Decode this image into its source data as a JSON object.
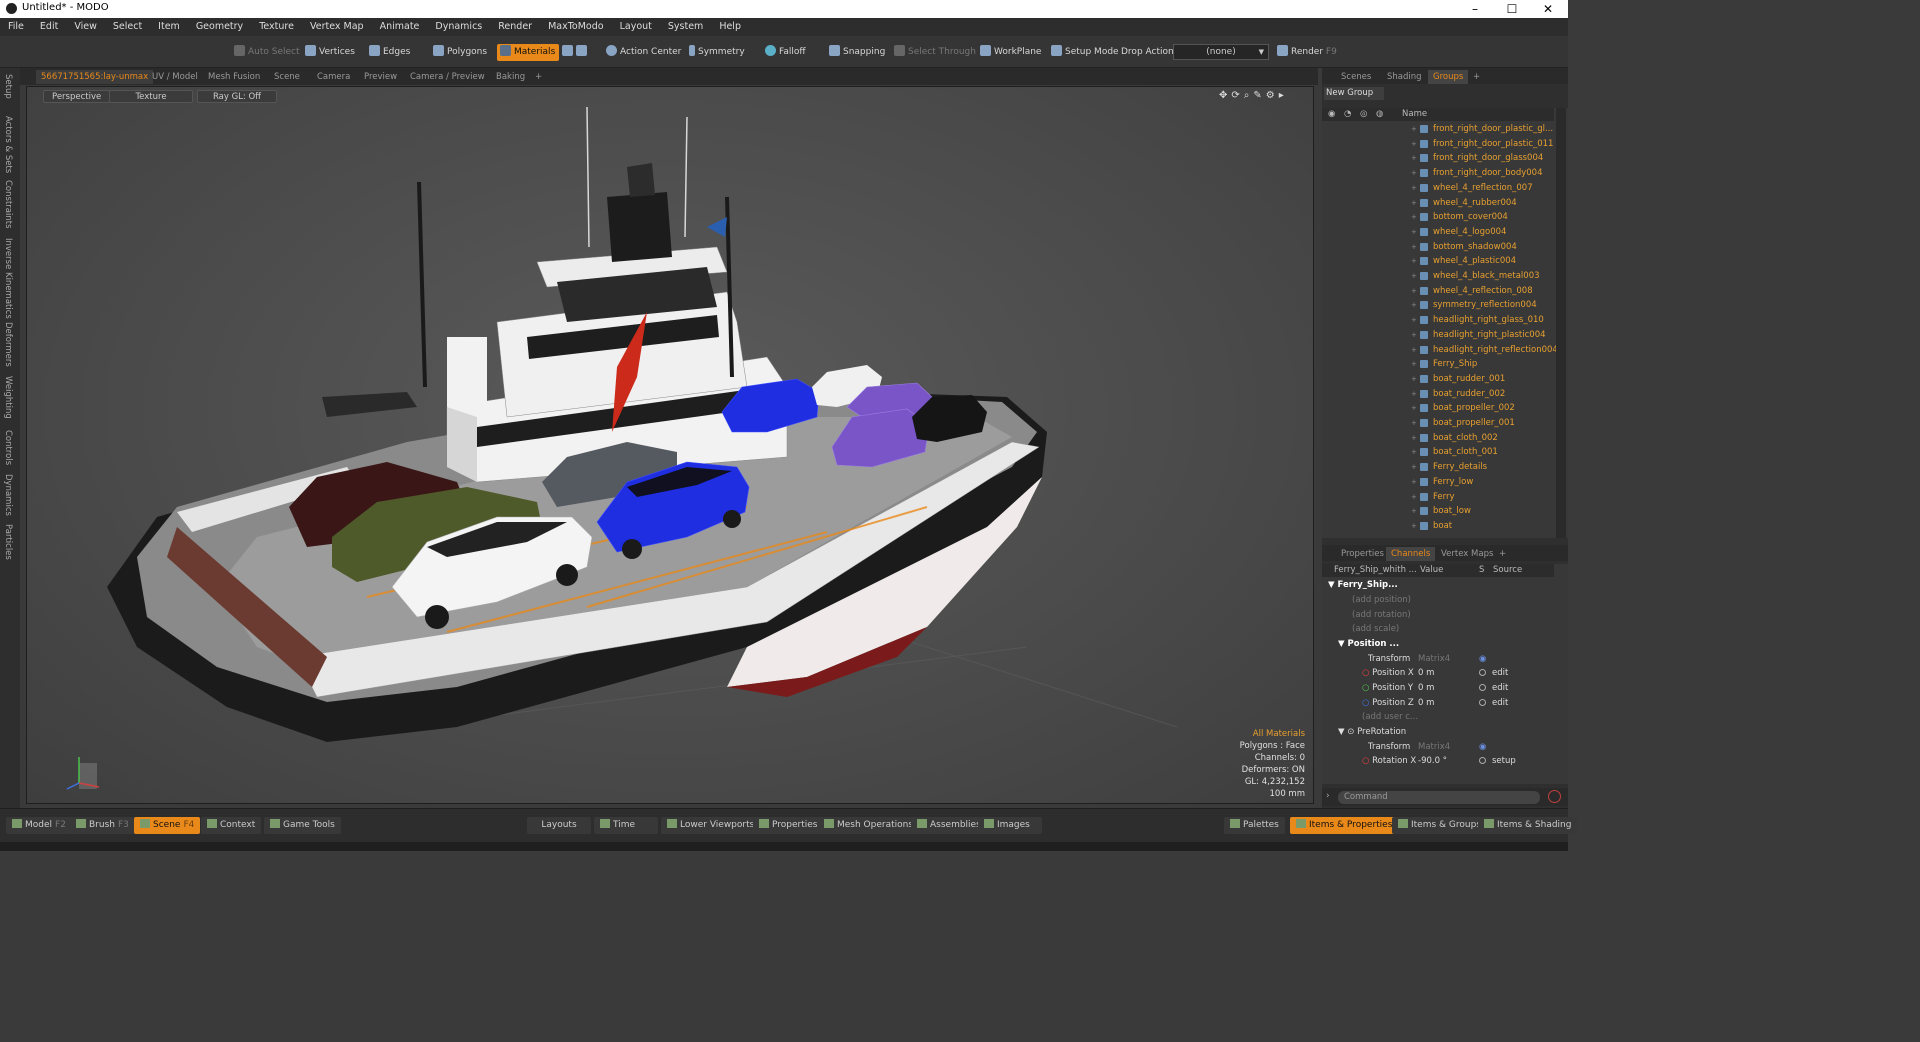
{
  "titlebar": {
    "title": "Untitled* - MODO",
    "minimize": "–",
    "maximize": "☐",
    "close": "✕"
  },
  "menu": [
    "File",
    "Edit",
    "View",
    "Select",
    "Item",
    "Geometry",
    "Texture",
    "Vertex Map",
    "Animate",
    "Dynamics",
    "Render",
    "MaxToModo",
    "Layout",
    "System",
    "Help"
  ],
  "toolbar": {
    "auto_select": "Auto Select",
    "vertices": "Vertices",
    "edges": "Edges",
    "polygons": "Polygons",
    "materials": "Materials",
    "action_center": "Action Center",
    "symmetry": "Symmetry",
    "falloff": "Falloff",
    "snapping": "Snapping",
    "select_through": "Select Through",
    "workplane": "WorkPlane",
    "setup_mode": "Setup Mode",
    "drop_action": "Drop Action",
    "drop_value": "(none)",
    "render": "Render",
    "render_key": "F9"
  },
  "left_tabs": [
    "Setup",
    "Actors & Sets",
    "Constraints",
    "Inverse Kinematics",
    "Deformers",
    "Weighting",
    "Controls",
    "Dynamics",
    "Particles"
  ],
  "viewport_tabs": [
    "56671751565:lay-unmax",
    "UV / Model",
    "Mesh Fusion",
    "Scene",
    "Camera",
    "Preview",
    "Camera / Preview",
    "Baking",
    "+"
  ],
  "viewport": {
    "perspective": "Perspective",
    "texture": "Texture",
    "raygl": "Ray GL: Off"
  },
  "stats": {
    "all_materials": "All Materials",
    "polygons": "Polygons : Face",
    "channels": "Channels: 0",
    "deformers": "Deformers: ON",
    "gl": "GL: 4,232,152",
    "scale": "100 mm"
  },
  "right_tabs_top": [
    "Scenes",
    "Shading",
    "Groups",
    "+"
  ],
  "new_group": "New Group",
  "tree_header": "Name",
  "tree_items": [
    "front_right_door_plastic_gl...",
    "front_right_door_plastic_011",
    "front_right_door_glass004",
    "front_right_door_body004",
    "wheel_4_reflection_007",
    "wheel_4_rubber004",
    "bottom_cover004",
    "wheel_4_logo004",
    "bottom_shadow004",
    "wheel_4_plastic004",
    "wheel_4_black_metal003",
    "wheel_4_reflection_008",
    "symmetry_reflection004",
    "headlight_right_glass_010",
    "headlight_right_plastic004",
    "headlight_right_reflection004",
    "Ferry_Ship",
    "boat_rudder_001",
    "boat_rudder_002",
    "boat_propeller_002",
    "boat_propeller_001",
    "boat_cloth_002",
    "boat_cloth_001",
    "Ferry_details",
    "Ferry_low",
    "Ferry",
    "boat_low",
    "boat"
  ],
  "right_tabs_bottom": [
    "Properties",
    "Channels",
    "Vertex Maps",
    "+"
  ],
  "channels_header": {
    "name": "Ferry_Ship_whith ...",
    "value": "Value",
    "s": "S",
    "source": "Source"
  },
  "channels": [
    {
      "name": "Ferry_Ship...",
      "value": "",
      "source": ""
    },
    {
      "name": "(add position)",
      "value": "",
      "source": ""
    },
    {
      "name": "(add rotation)",
      "value": "",
      "source": ""
    },
    {
      "name": "(add scale)",
      "value": "",
      "source": ""
    },
    {
      "name": "Position ...",
      "value": "",
      "source": ""
    },
    {
      "name": "Transform",
      "value": "Matrix4",
      "source": ""
    },
    {
      "name": "Position X",
      "value": "0 m",
      "source": "edit"
    },
    {
      "name": "Position Y",
      "value": "0 m",
      "source": "edit"
    },
    {
      "name": "Position Z",
      "value": "0 m",
      "source": "edit"
    },
    {
      "name": "(add user c...",
      "value": "",
      "source": ""
    },
    {
      "name": "PreRotation",
      "value": "",
      "source": ""
    },
    {
      "name": "Transform",
      "value": "Matrix4",
      "source": ""
    },
    {
      "name": "Rotation X",
      "value": "-90.0 °",
      "source": "setup"
    }
  ],
  "command_placeholder": "Command",
  "statusbar": {
    "model": "Model",
    "model_key": "F2",
    "brush": "Brush",
    "brush_key": "F3",
    "scene": "Scene",
    "scene_key": "F4",
    "context": "Context",
    "game_tools": "Game Tools",
    "layouts": "Layouts",
    "time": "Time",
    "lower_viewports": "Lower Viewports",
    "properties": "Properties",
    "mesh_operations": "Mesh Operations",
    "assemblies": "Assemblies",
    "images": "Images",
    "palettes": "Palettes",
    "items_properties": "Items & Properties",
    "items_groups": "Items & Groups",
    "items_shading": "Items & Shading"
  },
  "colors": {
    "accent": "#e8891a",
    "item_text": "#e8a030",
    "car_blue": "#1f2ee0",
    "car_purple": "#7a55c8"
  }
}
